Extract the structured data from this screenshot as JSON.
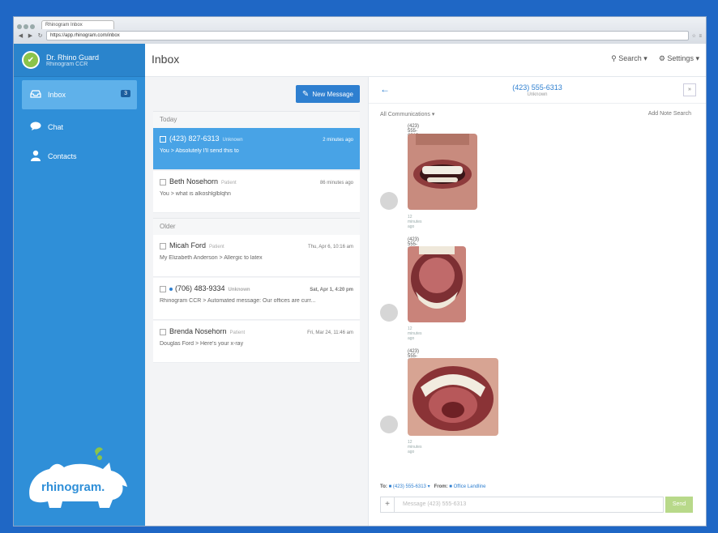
{
  "browser": {
    "tab_title": "Rhinogram Inbox",
    "address": "https://app.rhinogram.com/inbox",
    "tools": "☆ ≡"
  },
  "sidebar": {
    "user_name": "Dr. Rhino Guard",
    "user_org": "Rhinogram CCR",
    "items": [
      {
        "label": "Inbox",
        "icon": "inbox-icon",
        "badge": "3"
      },
      {
        "label": "Chat",
        "icon": "chat-icon"
      },
      {
        "label": "Contacts",
        "icon": "contacts-icon"
      }
    ],
    "logo_text": "rhinogram."
  },
  "header": {
    "title": "Inbox",
    "search_label": "Search",
    "settings_label": "Settings"
  },
  "list": {
    "new_message_label": "New Message",
    "groups": {
      "today": "Today",
      "older": "Older"
    },
    "items": [
      {
        "name": "(423) 827-6313",
        "tag": "Unknown",
        "time": "2 minutes ago",
        "preview": "You > Absolutely I'll send this to"
      },
      {
        "name": "Beth Nosehorn",
        "tag": "Patient",
        "time": "86 minutes ago",
        "preview": "You > what is alkoshlglblqhn"
      },
      {
        "name": "Micah Ford",
        "tag": "Patient",
        "time": "Thu, Apr 6, 10:16 am",
        "preview": "My Elizabeth Anderson > Allergic to latex"
      },
      {
        "name": "(706) 483-9334",
        "tag": "Unknown",
        "time": "Sat, Apr 1, 4:20 pm",
        "preview": "Rhinogram CCR > Automated message: Our offices are curr..."
      },
      {
        "name": "Brenda Nosehorn",
        "tag": "Patient",
        "time": "Fri, Mar 24, 11:46 am",
        "preview": "Douglas Ford > Here's your x-ray"
      }
    ]
  },
  "conversation": {
    "phone": "(423) 555-6313",
    "status": "Unknown",
    "filter_label": "All Communications",
    "note_label": "Add Note  Search",
    "messages": [
      {
        "from": "(423) 555-6313",
        "meta": "12 minutes ago"
      },
      {
        "from": "(423) 555-6313",
        "meta": "12 minutes ago"
      },
      {
        "from": "(423) 555-6313",
        "meta": "12 minutes ago"
      }
    ],
    "to_label": "To:",
    "to_value": "(423) 555-6313",
    "from_label": "From:",
    "from_value": "Office Landline",
    "input_placeholder": "Message (423) 555-6313",
    "send_label": "Send"
  },
  "colors": {
    "primary": "#2e7fd0",
    "sidebar": "#2f8fd8",
    "selected": "#48a3e6",
    "send": "#b8d98a"
  }
}
